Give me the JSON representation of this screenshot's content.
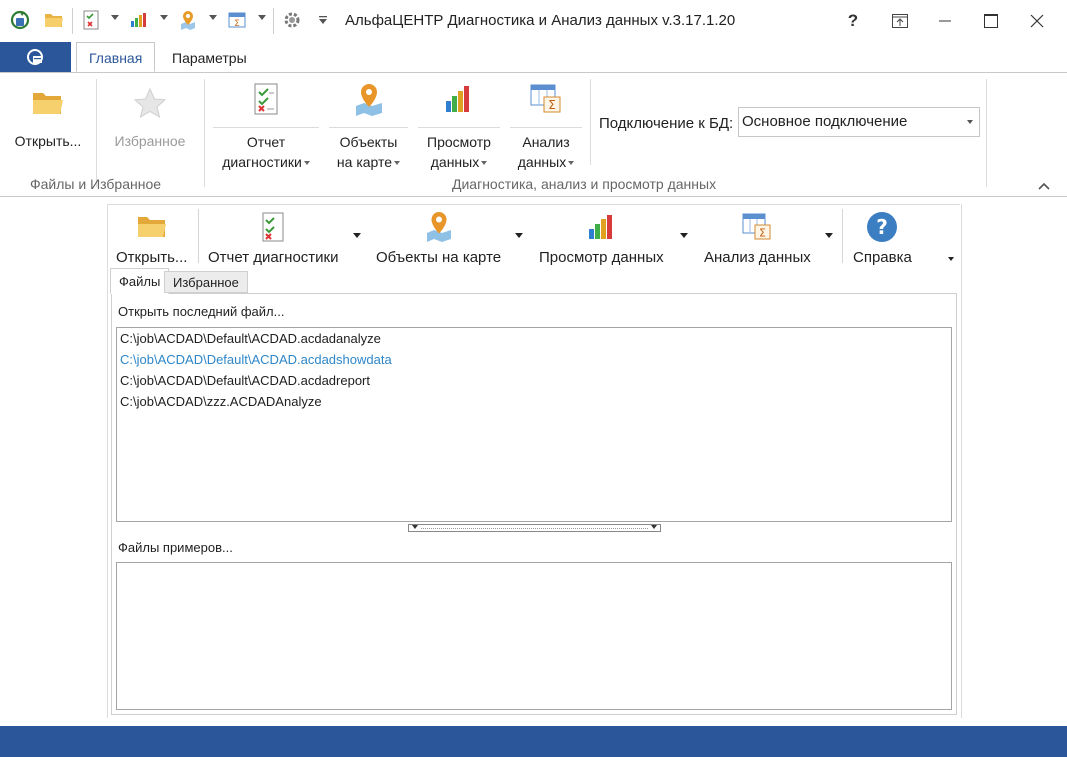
{
  "app": {
    "title": "АльфаЦЕНТР Диагностика и Анализ данных v.3.17.1.20",
    "accent_color": "#2b579a",
    "window_controls": {
      "help": "?",
      "restore_icon": "restore-icon",
      "maximize_icon": "maximize-icon",
      "close_icon": "close-icon"
    }
  },
  "quick_access": {
    "icons": [
      "refresh-db-icon",
      "open-folder-icon",
      "report-icon",
      "chart-icon",
      "map-pin-icon",
      "analysis-table-icon",
      "gear-icon",
      "customize-dropdown-icon"
    ]
  },
  "ribbon": {
    "tabs": [
      "Главная",
      "Параметры"
    ],
    "active_tab": "Главная",
    "groups": [
      {
        "label": "Файлы и Избранное",
        "buttons": [
          {
            "label": "Открыть...",
            "icon": "open-folder-icon",
            "enabled": true
          },
          {
            "label": "Избранное",
            "icon": "star-icon",
            "enabled": false
          }
        ]
      },
      {
        "label": "Диагностика, анализ и просмотр данных",
        "buttons": [
          {
            "line1": "Отчет",
            "line2": "диагностики",
            "icon": "report-icon"
          },
          {
            "line1": "Объекты",
            "line2": "на карте",
            "icon": "map-pin-icon"
          },
          {
            "line1": "Просмотр",
            "line2": "данных",
            "icon": "chart-icon"
          },
          {
            "line1": "Анализ",
            "line2": "данных",
            "icon": "analysis-table-icon"
          }
        ]
      }
    ],
    "db_connection": {
      "label": "Подключение к БД:",
      "value": "Основное подключение"
    }
  },
  "toolbar": {
    "buttons": [
      {
        "label": "Открыть...",
        "icon": "open-folder-icon"
      },
      {
        "label": "Отчет диагностики",
        "icon": "report-icon"
      },
      {
        "label": "Объекты на карте",
        "icon": "map-pin-icon"
      },
      {
        "label": "Просмотр данных",
        "icon": "chart-icon"
      },
      {
        "label": "Анализ данных",
        "icon": "analysis-table-icon"
      },
      {
        "label": "Справка",
        "icon": "help-icon"
      }
    ]
  },
  "inner_tabs": [
    "Файлы",
    "Избранное"
  ],
  "files_tab": {
    "recent_title": "Открыть последний файл...",
    "recent_files": [
      "C:\\job\\ACDAD\\Default\\ACDAD.acdadanalyze",
      "C:\\job\\ACDAD\\Default\\ACDAD.acdadshowdata",
      "C:\\job\\ACDAD\\Default\\ACDAD.acdadreport",
      "C:\\job\\ACDAD\\zzz.ACDADAnalyze"
    ],
    "selected_index": 1,
    "examples_title": "Файлы примеров...",
    "example_files": []
  }
}
